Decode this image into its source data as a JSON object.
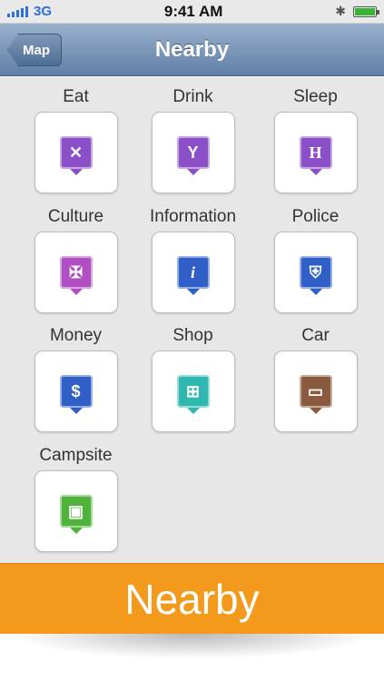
{
  "status": {
    "carrier": "3G",
    "time": "9:41 AM"
  },
  "nav": {
    "back_label": "Map",
    "title": "Nearby"
  },
  "colors": {
    "accent": "#f39a1c",
    "navbar": "#6f8cb2"
  },
  "categories": [
    {
      "label": "Eat",
      "icon": "utensils-icon",
      "color": "#8b4fc7"
    },
    {
      "label": "Drink",
      "icon": "drinks-icon",
      "color": "#8b4fc7"
    },
    {
      "label": "Sleep",
      "icon": "hotel-icon",
      "color": "#8b4fc7"
    },
    {
      "label": "Culture",
      "icon": "windmill-icon",
      "color": "#b04fc2"
    },
    {
      "label": "Information",
      "icon": "info-icon",
      "color": "#2f5fc7"
    },
    {
      "label": "Police",
      "icon": "shield-icon",
      "color": "#2f5fc7"
    },
    {
      "label": "Money",
      "icon": "money-bag-icon",
      "color": "#2f5fc7"
    },
    {
      "label": "Shop",
      "icon": "cart-icon",
      "color": "#2fb8b0"
    },
    {
      "label": "Car",
      "icon": "car-icon",
      "color": "#8a5a3f"
    },
    {
      "label": "Campsite",
      "icon": "caravan-icon",
      "color": "#4fb23a"
    }
  ],
  "footer": {
    "label": "Nearby"
  }
}
